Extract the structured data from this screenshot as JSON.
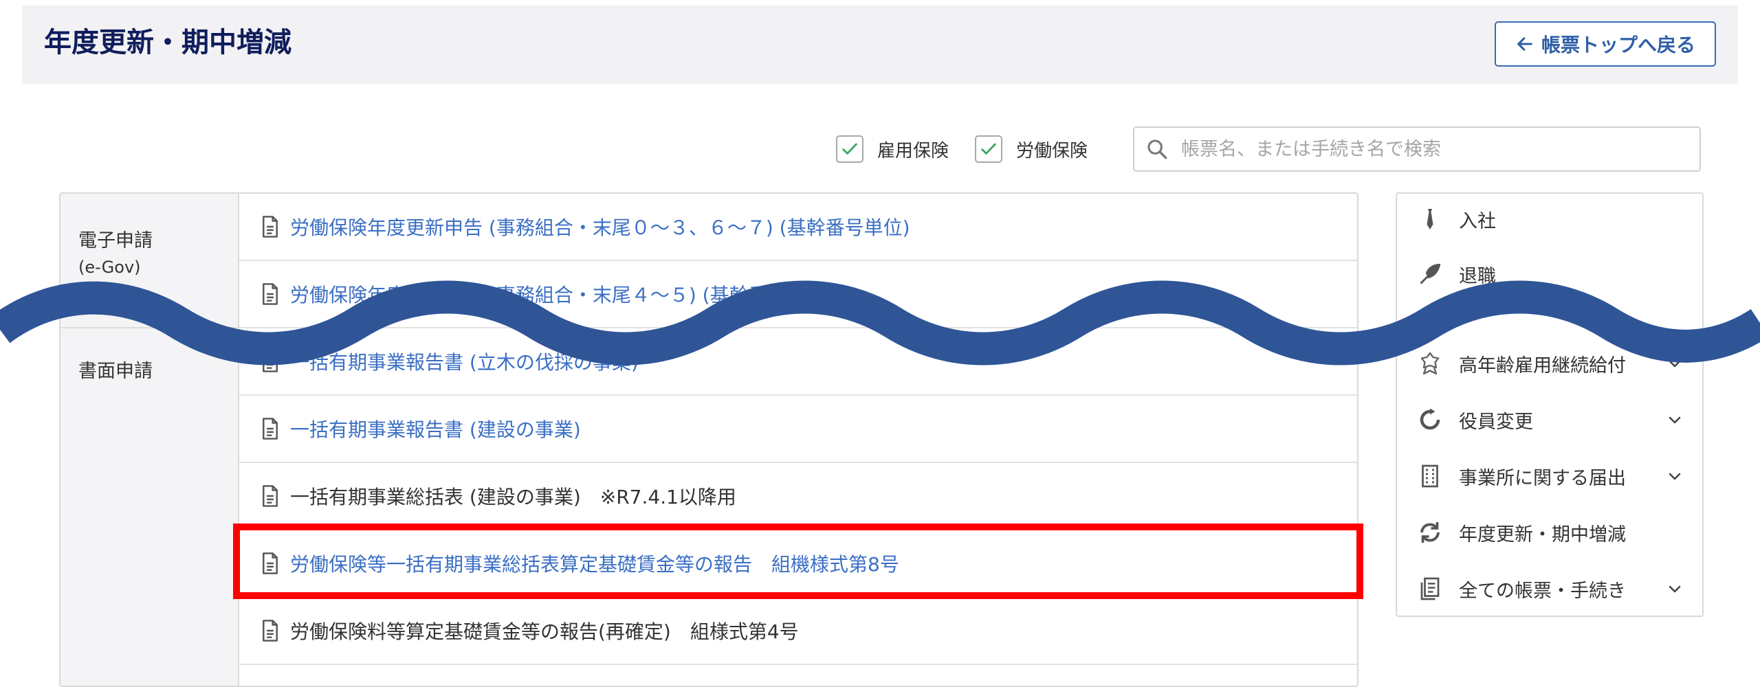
{
  "header": {
    "title": "年度更新・期中増減",
    "back_button_label": "帳票トップへ戻る"
  },
  "filters": {
    "koyo_label": "雇用保険",
    "koyo_checked": true,
    "rodo_label": "労働保険",
    "rodo_checked": true,
    "search_placeholder": "帳票名、または手続き名で検索",
    "search_value": ""
  },
  "sections": {
    "electronic": {
      "label": "電子申請",
      "sub": "(e-Gov)"
    },
    "paper": {
      "label": "書面申請"
    }
  },
  "rows": [
    {
      "text": "労働保険年度更新申告 (事務組合・末尾０～３、６～７) (基幹番号単位)",
      "link": true
    },
    {
      "text": "労働保険年度更新申告 (事務組合・末尾４～５) (基幹番号単位)",
      "link": true
    },
    {
      "text": "一括有期事業報告書 (立木の伐採の事業)",
      "link": true
    },
    {
      "text": "一括有期事業報告書 (建設の事業)",
      "link": true
    },
    {
      "text": "一括有期事業総括表 (建設の事業)　※R7.4.1以降用",
      "link": false
    },
    {
      "text": "労働保険等一括有期事業総括表算定基礎賃金等の報告　組機様式第8号",
      "link": true
    },
    {
      "text": "労働保険料等算定基礎賃金等の報告(再確定)　組様式第4号",
      "link": false
    }
  ],
  "sidebar": {
    "items": [
      {
        "label": "入社",
        "icon": "tie-icon",
        "expandable": false
      },
      {
        "label": "退職",
        "icon": "bouquet-icon",
        "expandable": false
      },
      {
        "label": "高年齢雇用継続給付",
        "icon": "badge-icon",
        "expandable": true
      },
      {
        "label": "役員変更",
        "icon": "refresh-circle-icon",
        "expandable": true
      },
      {
        "label": "事業所に関する届出",
        "icon": "building-icon",
        "expandable": true
      },
      {
        "label": "年度更新・期中増減",
        "icon": "sync-icon",
        "expandable": false
      },
      {
        "label": "全ての帳票・手続き",
        "icon": "documents-icon",
        "expandable": true
      }
    ]
  },
  "colors": {
    "title": "#101d5c",
    "link": "#3b6fc4",
    "highlight": "#ff0000",
    "wave": "#2f5597",
    "check": "#3aa55f"
  }
}
